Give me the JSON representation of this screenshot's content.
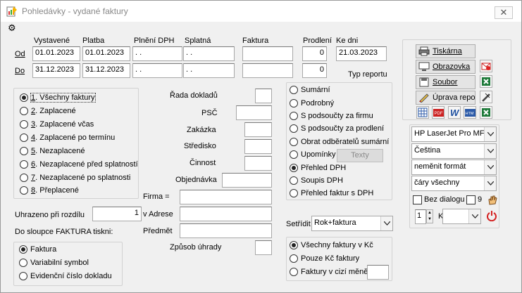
{
  "window": {
    "title": "Pohledávky - vydané faktury",
    "close_symbol": "✕",
    "gear_symbol": "⚙"
  },
  "headers": {
    "vystavene": "Vystavené",
    "platba": "Platba",
    "plneni_dph": "Plnění DPH",
    "splatna": "Splatná",
    "faktura": "Faktura",
    "prodleni": "Prodlení",
    "ke_dni": "Ke dni"
  },
  "rows": {
    "od": {
      "label": "Od",
      "vystavene": "01.01.2023",
      "platba": "01.01.2023",
      "plneni_dph": " .  .",
      "splatna": " .  .",
      "faktura": "",
      "prodleni": "0",
      "ke_dni": "21.03.2023"
    },
    "do": {
      "label": "Do",
      "vystavene": "31.12.2023",
      "platba": "31.12.2023",
      "plneni_dph": " .  .",
      "splatna": " .  .",
      "faktura": "",
      "prodleni": "0"
    }
  },
  "filter_options": [
    {
      "num": "1",
      "label": ". Všechny faktury",
      "selected": true
    },
    {
      "num": "2",
      "label": ". Zaplacené",
      "selected": false
    },
    {
      "num": "3",
      "label": ". Zaplacené včas",
      "selected": false
    },
    {
      "num": "4",
      "label": ". Zaplacené po termínu",
      "selected": false
    },
    {
      "num": "5",
      "label": ". Nezaplacené",
      "selected": false
    },
    {
      "num": "6",
      "label": ". Nezaplacené před splatností",
      "selected": false
    },
    {
      "num": "7",
      "label": ". Nezaplacené po splatnosti",
      "selected": false
    },
    {
      "num": "8",
      "label": ". Přeplacené",
      "selected": false
    }
  ],
  "fields": {
    "rada_dokladu": "Řada dokladů",
    "psc": "PSČ",
    "zakazka": "Zakázka",
    "stredisko": "Středisko",
    "cinnost": "Činnost",
    "objednavka": "Objednávka",
    "firma": "Firma =",
    "v_adrese": "v Adrese",
    "predmet": "Předmět",
    "zpusob_uhrady": "Způsob úhrady"
  },
  "uhrazeno": {
    "label": "Uhrazeno při rozdílu",
    "value": "1"
  },
  "do_sloupce": {
    "label": "Do sloupce FAKTURA tiskni:",
    "options": [
      {
        "label": "Faktura",
        "selected": true
      },
      {
        "label": "Variabilní symbol",
        "selected": false
      },
      {
        "label": "Evidenční číslo dokladu",
        "selected": false
      }
    ]
  },
  "typ_reportu": {
    "label": "Typ reportu",
    "options": [
      {
        "label": "Sumární",
        "selected": false
      },
      {
        "label": "Podrobný",
        "selected": false
      },
      {
        "label": "S podsoučty za firmu",
        "selected": false
      },
      {
        "label": "S podsoučty za prodlení",
        "selected": false
      },
      {
        "label": "Obrat odběratelů sumární",
        "selected": false
      },
      {
        "label": "Upomínky",
        "selected": false
      },
      {
        "label": "Přehled DPH",
        "selected": true
      },
      {
        "label": "Soupis DPH",
        "selected": false
      },
      {
        "label": "Přehled faktur s DPH",
        "selected": false
      }
    ],
    "texty_label": "Texty"
  },
  "setridit": {
    "label": "Setřídit",
    "value": "Rok+faktura"
  },
  "mena": {
    "options": [
      {
        "label": "Všechny faktury v Kč",
        "selected": true
      },
      {
        "label": "Pouze Kč faktury",
        "selected": false
      },
      {
        "label": "Faktury v cizí měně",
        "selected": false
      }
    ]
  },
  "output": {
    "tiskarna": "Tiskárna",
    "obrazovka": "Obrazovka",
    "soubor": "Soubor",
    "uprava": "Úprava repor",
    "printer": "HP LaserJet Pro MFP",
    "language": "Čeština",
    "format": "neměnit formát",
    "lines": "čáry všechny",
    "bez_dialogu": "Bez dialogu",
    "copies_label": "9",
    "spin_value": "1",
    "k_label": "K"
  },
  "colors": {
    "window_bg": "#f0f0f0",
    "border": "#adadad",
    "power_red": "#d42020",
    "excel_green": "#1e7a3a"
  }
}
